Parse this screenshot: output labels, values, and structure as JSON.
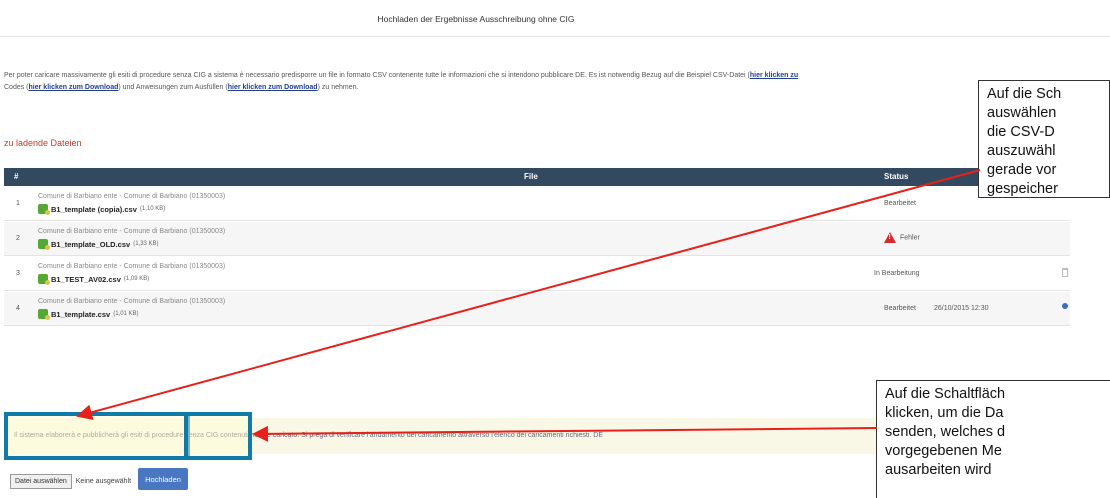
{
  "page": {
    "title": "Hochladen der Ergebnisse Ausschreibung ohne CIG"
  },
  "intro": {
    "text_1": "Per poter caricare massivamente gli esiti di procedure senza CIG a sistema è necessario predisporre un file in formato CSV contenente tutte le informazioni che si intendono pubblicare DE. Es ist notwendig Bezug auf die Beispiel CSV-Datei (",
    "link_1": "hier klicken zu",
    "text_2": "Codes (",
    "link_2": "hier klicken zum Download",
    "text_3": ") und Anweisungen zum Ausfüllen (",
    "link_3": "hier klicken zum Download",
    "text_4": ") zu nehmen."
  },
  "section": {
    "title": "zu ladende Dateien"
  },
  "table": {
    "columns": {
      "num": "#",
      "file": "File",
      "status": "Status"
    },
    "rows": [
      {
        "num": "1",
        "entity": "Comune di Barbiano ente - Comune di Barbiano (01350003)",
        "file": "B1_template (copia).csv",
        "size": "(1,10 KB)",
        "status": "Bearbeitet",
        "date": ""
      },
      {
        "num": "2",
        "entity": "Comune di Barbiano ente - Comune di Barbiano (01350003)",
        "file": "B1_template_OLD.csv",
        "size": "(1,33 KB)",
        "status": "Fehler",
        "date": ""
      },
      {
        "num": "3",
        "entity": "Comune di Barbiano ente - Comune di Barbiano (01350003)",
        "file": "B1_TEST_AV02.csv",
        "size": "(1,09 KB)",
        "status": "In Bearbeitung",
        "date": ""
      },
      {
        "num": "4",
        "entity": "Comune di Barbiano ente - Comune di Barbiano (01350003)",
        "file": "B1_template.csv",
        "size": "(1,01 KB)",
        "status": "Bearbeitet",
        "date": "26/10/2015 12:30"
      }
    ]
  },
  "info_bar": {
    "text": "Il sistema elaborerà e pubblicherà gli esiti di procedure senza CIG contenuti nel file caricato. Si prega di verificare l'andamento del caricamento attraverso l'elenco dei caricamenti richiesti. DE"
  },
  "upload": {
    "choose_label": "Datei auswählen",
    "no_file": "Keine ausgewählt",
    "upload_label": "Hochladen"
  },
  "callout_1": {
    "lines": [
      "Auf die Sch",
      "auswählen",
      "die CSV-D",
      "auszuwähl",
      "gerade vor",
      "gespeicher"
    ]
  },
  "callout_2": {
    "lines": [
      "Auf die Schaltfläch",
      "klicken, um die Da",
      "senden, welches d",
      "vorgegebenen Me",
      "ausarbeiten wird"
    ]
  },
  "colors": {
    "table_header": "#33495f",
    "highlight_border": "#127aa6",
    "arrow": "#e8201a",
    "error": "#d52b2b",
    "upload_button": "#4a77c2"
  }
}
